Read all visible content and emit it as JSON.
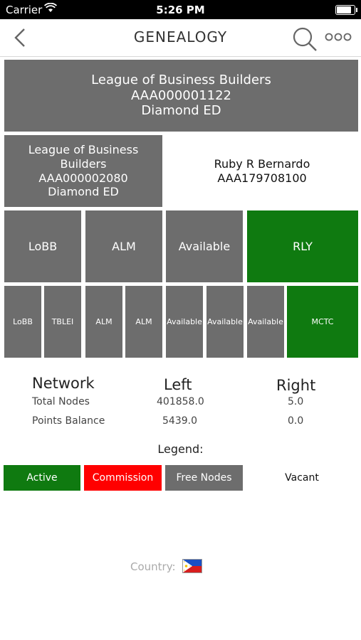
{
  "status_bar": {
    "carrier": "Carrier",
    "time": "5:26 PM",
    "battery_level": 0.9
  },
  "nav": {
    "title": "GENEALOGY",
    "back_icon": "chevron-left-icon",
    "search_icon": "search-icon",
    "more_icon": "more-horizontal-icon"
  },
  "tree": {
    "root": {
      "name": "League of Business Builders",
      "id": "AAA000001122",
      "rank": "Diamond ED"
    },
    "left": {
      "name": "League of Business Builders",
      "id": "AAA000002080",
      "rank": "Diamond ED"
    },
    "right": {
      "name": "Ruby R Bernardo",
      "id": "AAA179708100"
    },
    "level3": [
      "LoBB",
      "ALM",
      "Available",
      "RLY"
    ],
    "level4": [
      "LoBB",
      "TBLEI",
      "ALM",
      "ALM",
      "Available",
      "Available",
      "Available",
      "MCTC"
    ]
  },
  "summary": {
    "header_network": "Network",
    "header_left": "Left",
    "header_right": "Right",
    "rows": [
      {
        "label": "Total Nodes",
        "left": "401858.0",
        "right": "5.0"
      },
      {
        "label": "Points Balance",
        "left": "5439.0",
        "right": "0.0"
      }
    ]
  },
  "legend": {
    "title": "Legend:",
    "items": [
      {
        "label": "Active",
        "color": "#0f7a10"
      },
      {
        "label": "Commission",
        "color": "#ff0000"
      },
      {
        "label": "Free Nodes",
        "color": "#6d6d6d"
      },
      {
        "label": "Vacant",
        "color": "#ffffff"
      }
    ]
  },
  "country": {
    "label": "Country:",
    "flag_icon": "philippines-flag-icon"
  },
  "colors": {
    "node_gray": "#6d6d6d",
    "active_green": "#0f7a10",
    "commission_red": "#ff0000"
  }
}
